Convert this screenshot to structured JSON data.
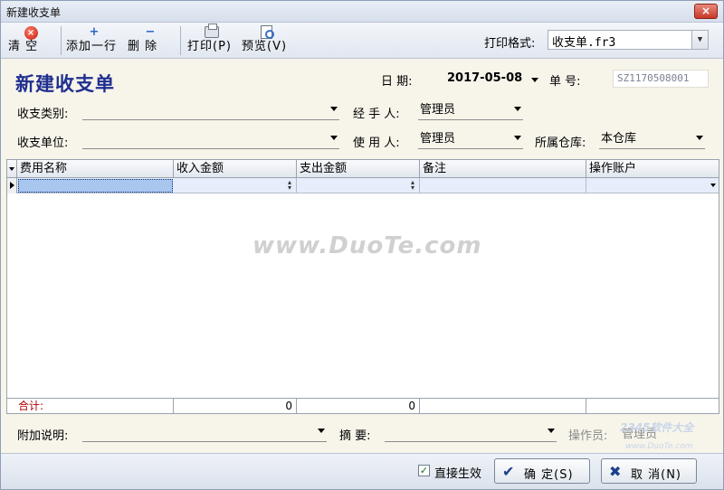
{
  "window": {
    "title": "新建收支单",
    "close_label": "×"
  },
  "toolbar": {
    "clear_label": "清 空",
    "add_row_label": "添加一行",
    "delete_label": "删 除",
    "print_label": "打印(P)",
    "preview_label": "预览(V)",
    "print_format_label": "打印格式:",
    "print_format_value": "收支单.fr3"
  },
  "form": {
    "title": "新建收支单",
    "date_label": "日    期:",
    "date_value": "2017-05-08",
    "doc_no_label": "单    号:",
    "doc_no_value": "SZ1170508001",
    "category_label": "收支类别:",
    "category_value": "",
    "handler_label": "经 手 人:",
    "handler_value": "管理员",
    "unit_label": "收支单位:",
    "unit_value": "",
    "user_label": "使 用 人:",
    "user_value": "管理员",
    "warehouse_label": "所属仓库:",
    "warehouse_value": "本仓库"
  },
  "grid": {
    "columns": [
      "费用名称",
      "收入金额",
      "支出金额",
      "备注",
      "操作账户"
    ],
    "total_label": "合计:",
    "income_total": "0",
    "expense_total": "0"
  },
  "watermark": "www.DuoTe.com",
  "footer": {
    "note_label": "附加说明:",
    "summary_label": "摘  要:",
    "operator_label": "操作员:",
    "operator_value": "管理员",
    "site_logo": "2345软件大全",
    "site_url": "www.DuoTe.com",
    "auto_effect_label": "直接生效",
    "confirm_label": "确  定(S)",
    "cancel_label": "取  消(N)"
  }
}
